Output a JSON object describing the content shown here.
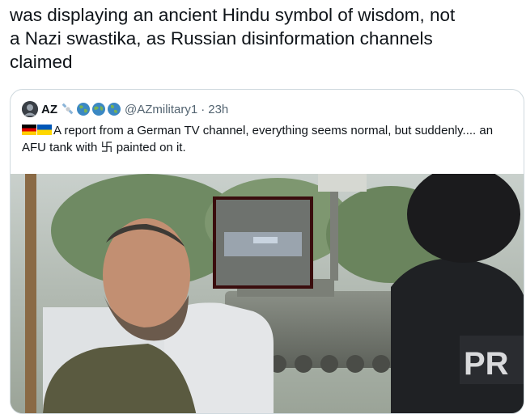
{
  "tweet": {
    "text": "was displaying an ancient Hindu symbol of wisdom, not\na Nazi swastika, as Russian disinformation channels\nclaimed"
  },
  "quoted_tweet": {
    "display_name": "AZ",
    "handle": "@AZmilitary1",
    "separator": "·",
    "time": "23h",
    "text_before_symbol": "A report from a German TV channel, everything seems normal, but suddenly.... an AFU tank with ",
    "symbol": "卐",
    "text_after_symbol": " painted on it.",
    "media": {
      "vest_label": "PR"
    }
  }
}
